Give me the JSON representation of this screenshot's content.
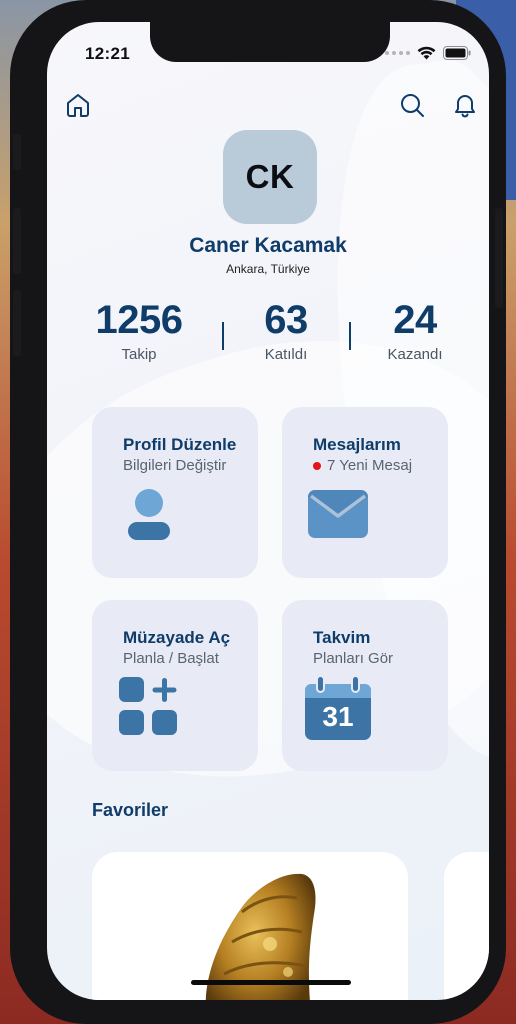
{
  "status_bar": {
    "time": "12:21"
  },
  "header": {
    "home_icon": "home-icon",
    "search_icon": "search-icon",
    "notification_icon": "bell-icon"
  },
  "profile": {
    "initials": "CK",
    "name": "Caner Kacamak",
    "location": "Ankara, Türkiye"
  },
  "stats": [
    {
      "value": "1256",
      "label": "Takip"
    },
    {
      "value": "63",
      "label": "Katıldı"
    },
    {
      "value": "24",
      "label": "Kazandı"
    }
  ],
  "cards": [
    {
      "title": "Profil Düzenle",
      "subtitle": "Bilgileri Değiştir",
      "icon": "user-icon"
    },
    {
      "title": "Mesajlarım",
      "subtitle": "7 Yeni Mesaj",
      "icon": "envelope-icon"
    },
    {
      "title": "Müzayade Aç",
      "subtitle": "Planla / Başlat",
      "icon": "grid-plus-icon"
    },
    {
      "title": "Takvim",
      "subtitle": "Planları Gör",
      "icon": "calendar-icon",
      "calendar_day": "31"
    }
  ],
  "favorites": {
    "title": "Favoriler"
  },
  "colors": {
    "primary": "#0f3c68",
    "accent": "#3d74a6",
    "accent_light": "#6ea6d6",
    "card_bg": "#e8ebf6",
    "avatar_bg": "#b9cad9",
    "notification_dot": "#e3141a"
  }
}
